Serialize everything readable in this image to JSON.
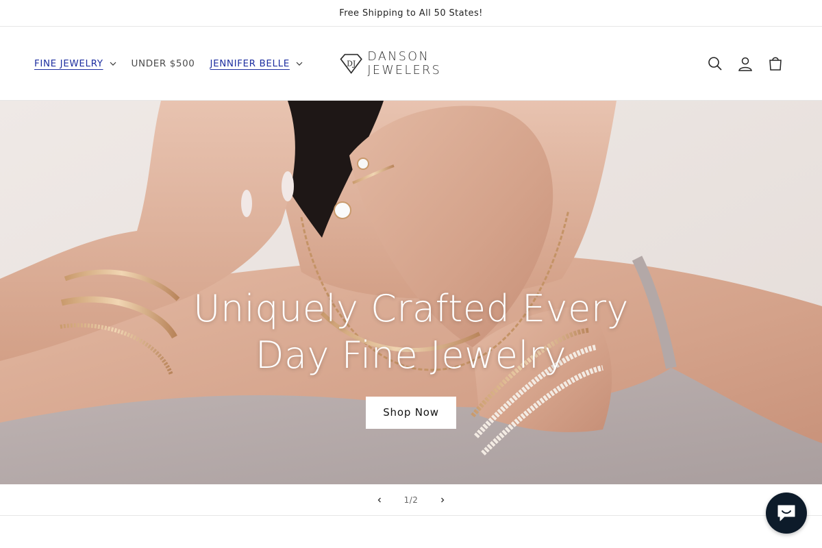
{
  "announcement": {
    "text": "Free Shipping to All 50 States!"
  },
  "nav": {
    "items": [
      {
        "label": "FINE JEWELRY",
        "dropdown": true,
        "active": true
      },
      {
        "label": "UNDER $500",
        "dropdown": false,
        "active": false
      },
      {
        "label": "JENNIFER BELLE",
        "dropdown": true,
        "active": true
      }
    ]
  },
  "brand": {
    "name": "DANSON JEWELERS",
    "monogram": "DJ"
  },
  "header_icons": [
    "search-icon",
    "account-icon",
    "cart-icon"
  ],
  "hero": {
    "title": "Uniquely Crafted Every Day Fine Jewelry",
    "button_label": "Shop Now"
  },
  "slider": {
    "counter": "1/2"
  },
  "colors": {
    "nav_link": "#1d2ea0",
    "chat_bubble": "#0d1b2a",
    "text": "#121212"
  }
}
